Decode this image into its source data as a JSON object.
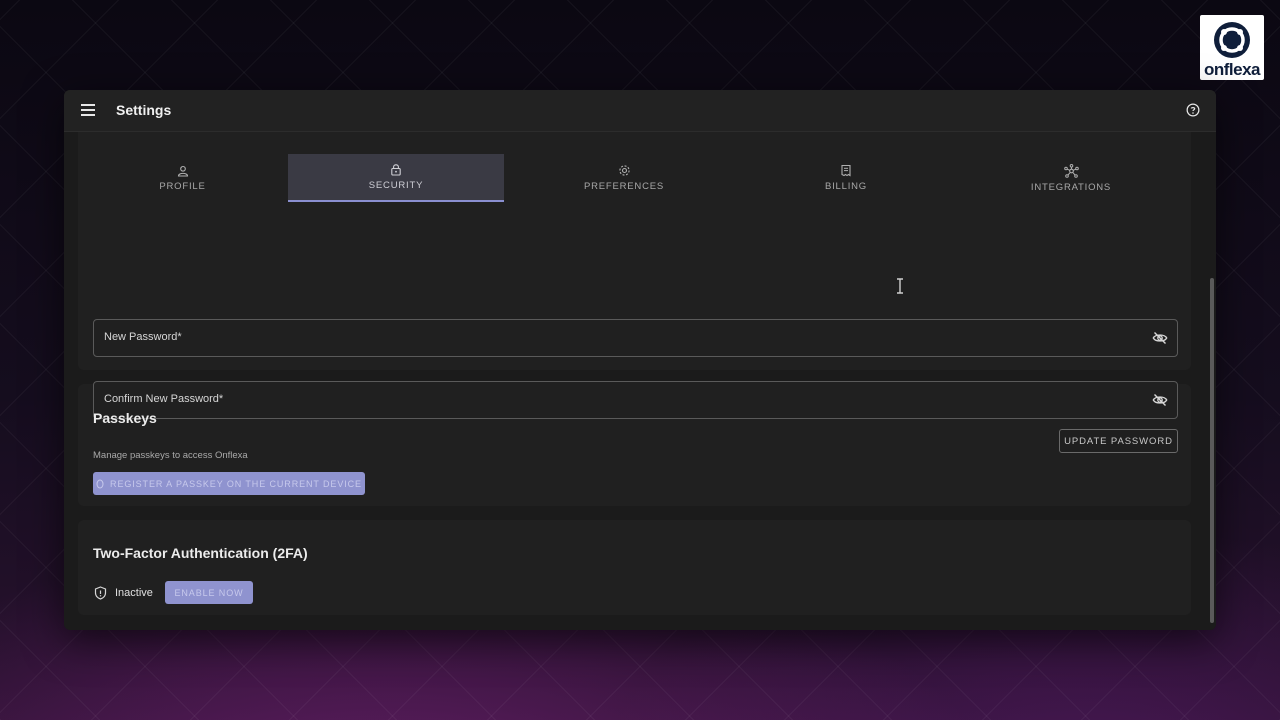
{
  "brand": {
    "logo_text": "onflexa"
  },
  "window": {
    "title": "Settings"
  },
  "tabs": [
    {
      "label": "PROFILE",
      "icon": "person-icon",
      "active": false
    },
    {
      "label": "SECURITY",
      "icon": "lock-icon",
      "active": true
    },
    {
      "label": "PREFERENCES",
      "icon": "gear-icon",
      "active": false
    },
    {
      "label": "BILLING",
      "icon": "receipt-icon",
      "active": false
    },
    {
      "label": "INTEGRATIONS",
      "icon": "hub-icon",
      "active": false
    }
  ],
  "password": {
    "new_label": "New Password*",
    "confirm_label": "Confirm New Password*",
    "update_label": "UPDATE PASSWORD"
  },
  "passkeys": {
    "title": "Passkeys",
    "description": "Manage passkeys to access Onflexa",
    "register_label": "REGISTER A PASSKEY ON THE CURRENT DEVICE"
  },
  "two_factor": {
    "title": "Two-Factor Authentication (2FA)",
    "status": "Inactive",
    "enable_label": "ENABLE NOW"
  },
  "colors": {
    "accent": "#8f93cf",
    "tab_active_bg": "#3a3a44",
    "surface": "#202020",
    "window_bg": "#1b1b1b"
  }
}
